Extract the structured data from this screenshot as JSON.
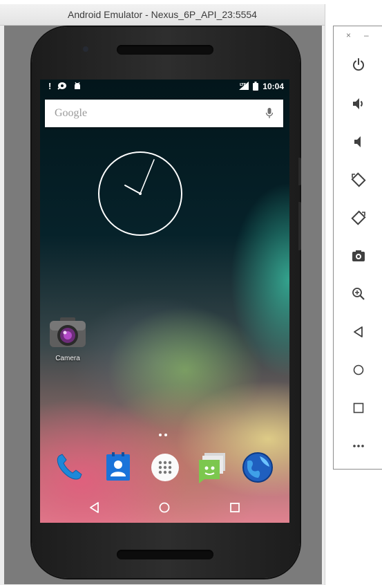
{
  "window": {
    "title": "Android Emulator - Nexus_6P_API_23:5554"
  },
  "status_bar": {
    "left_icons": [
      "alert-icon",
      "sync-icon",
      "android-debug-icon"
    ],
    "right_icons": [
      "signal-icon",
      "battery-icon"
    ],
    "time": "10:04"
  },
  "search_widget": {
    "placeholder": "Google",
    "mic_icon": "mic-icon"
  },
  "clock_widget": {
    "display": "analog",
    "hour_hand_points_to": 8,
    "minute_hand_points_to": 1
  },
  "desktop_apps": [
    {
      "label": "Camera",
      "icon": "camera-icon"
    }
  ],
  "dock_apps": [
    {
      "name": "Phone",
      "icon": "phone-icon"
    },
    {
      "name": "Contacts",
      "icon": "contacts-icon"
    },
    {
      "name": "Apps",
      "icon": "apps-drawer-icon"
    },
    {
      "name": "Messaging",
      "icon": "messaging-icon"
    },
    {
      "name": "Browser",
      "icon": "browser-icon"
    }
  ],
  "nav_bar": [
    "back-icon",
    "home-icon",
    "recents-icon"
  ],
  "extended_controls": {
    "header": {
      "close": "×",
      "minimize": "–"
    },
    "tools": [
      "power-icon",
      "volume-up-icon",
      "volume-down-icon",
      "rotate-left-icon",
      "rotate-right-icon",
      "screenshot-icon",
      "zoom-icon",
      "back-icon",
      "home-icon",
      "overview-icon",
      "more-icon"
    ]
  },
  "colors": {
    "panel_icon": "#404040",
    "screen_background": "#03161b",
    "phone_body": "#262626"
  }
}
